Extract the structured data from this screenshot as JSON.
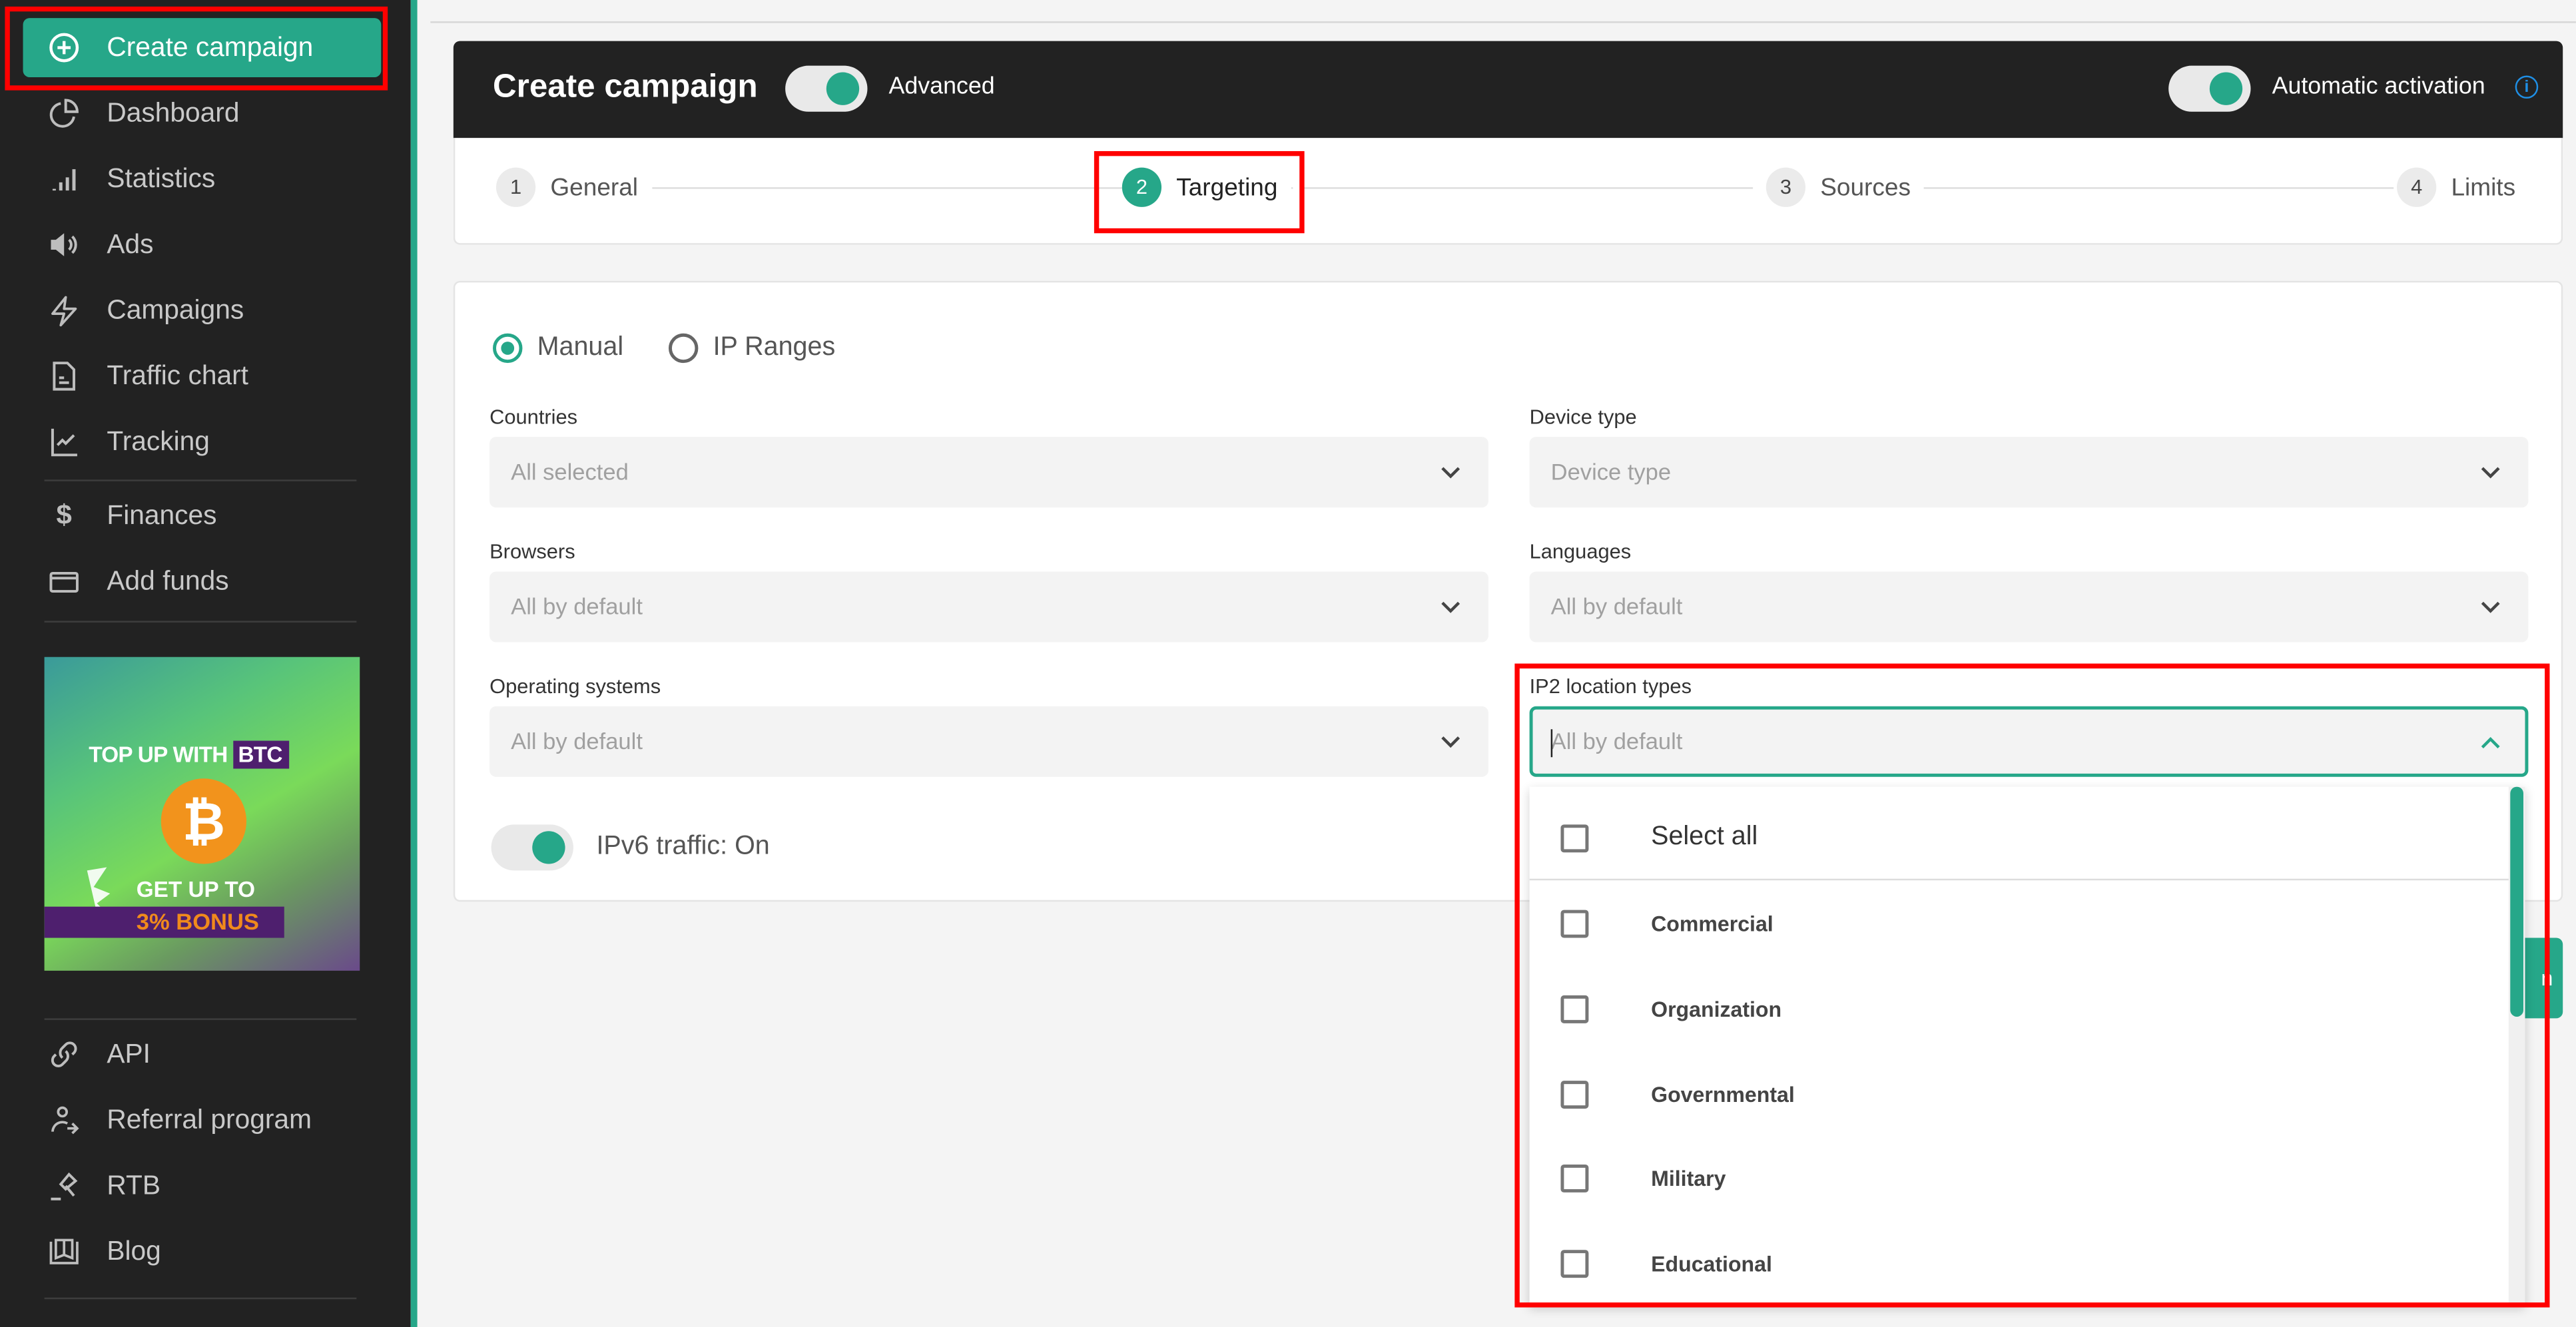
{
  "sidebar": {
    "items": [
      {
        "label": "Create campaign",
        "icon": "plus-circle-icon",
        "active": true
      },
      {
        "label": "Dashboard",
        "icon": "pie-chart-icon"
      },
      {
        "label": "Statistics",
        "icon": "signal-bars-icon"
      },
      {
        "label": "Ads",
        "icon": "speaker-icon"
      },
      {
        "label": "Campaigns",
        "icon": "lightning-icon"
      },
      {
        "label": "Traffic chart",
        "icon": "document-icon"
      },
      {
        "label": "Tracking",
        "icon": "line-chart-icon"
      },
      {
        "label": "Finances",
        "icon": "dollar-icon"
      },
      {
        "label": "Add funds",
        "icon": "credit-card-icon"
      },
      {
        "label": "API",
        "icon": "link-icon"
      },
      {
        "label": "Referral program",
        "icon": "referral-user-icon"
      },
      {
        "label": "RTB",
        "icon": "gavel-icon"
      },
      {
        "label": "Blog",
        "icon": "book-icon"
      }
    ],
    "promo": {
      "line1": "TOP UP WITH ",
      "line1_highlight": "BTC",
      "coin": "₿",
      "line2": "GET UP TO",
      "line3": "3% BONUS"
    }
  },
  "header": {
    "title": "Create campaign",
    "advanced_label": "Advanced",
    "advanced_on": true,
    "auto_activation_label": "Automatic activation",
    "auto_activation_on": true,
    "info_icon": "i"
  },
  "steps": [
    {
      "num": "1",
      "label": "General"
    },
    {
      "num": "2",
      "label": "Targeting",
      "active": true
    },
    {
      "num": "3",
      "label": "Sources"
    },
    {
      "num": "4",
      "label": "Limits"
    }
  ],
  "form": {
    "mode_options": [
      {
        "label": "Manual",
        "selected": true
      },
      {
        "label": "IP Ranges",
        "selected": false
      }
    ],
    "fields": {
      "countries": {
        "label": "Countries",
        "value": "All selected"
      },
      "device_type": {
        "label": "Device type",
        "value": "Device type"
      },
      "browsers": {
        "label": "Browsers",
        "value": "All by default"
      },
      "languages": {
        "label": "Languages",
        "value": "All by default"
      },
      "operating_systems": {
        "label": "Operating systems",
        "value": "All by default"
      },
      "ip2_location_types": {
        "label": "IP2 location types",
        "placeholder": "All by default"
      }
    },
    "ipv6_label": "IPv6 traffic: On",
    "ipv6_on": true
  },
  "dropdown": {
    "select_all": "Select all",
    "options": [
      "Commercial",
      "Organization",
      "Governmental",
      "Military",
      "Educational"
    ]
  },
  "next_button_fragment": "n",
  "colors": {
    "accent": "#26a789",
    "sidebar_bg": "#222222",
    "highlight": "#ff0000",
    "info": "#1f8fe5"
  }
}
